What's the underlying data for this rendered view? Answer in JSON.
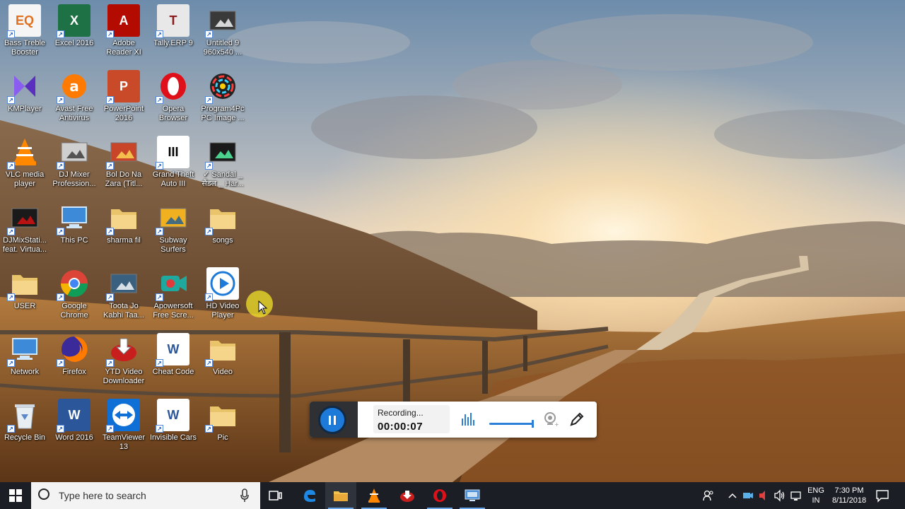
{
  "desktop_icons": [
    {
      "label": "Bass Treble\nBooster",
      "icon": "bass-treble-booster-icon",
      "bg": "#f5f5f5",
      "fg": "#e07020",
      "text": "EQ",
      "col": 0,
      "row": 0
    },
    {
      "label": "Excel 2016",
      "icon": "excel-icon",
      "bg": "#1e7145",
      "fg": "#ffffff",
      "text": "X",
      "col": 1,
      "row": 0
    },
    {
      "label": "Adobe\nReader XI",
      "icon": "adobe-reader-icon",
      "bg": "#b30b00",
      "fg": "#ffffff",
      "text": "A",
      "col": 2,
      "row": 0
    },
    {
      "label": "Tally.ERP 9",
      "icon": "tally-icon",
      "bg": "#e8e8e8",
      "fg": "#8a1a1a",
      "text": "T",
      "col": 3,
      "row": 0
    },
    {
      "label": "Untitled 9\n960x540 ...",
      "icon": "image-file-icon",
      "bg": "#3a3a3a",
      "fg": "#ffffff",
      "text": "",
      "col": 4,
      "row": 0
    },
    {
      "label": "KMPlayer",
      "icon": "kmplayer-icon",
      "bg": "#6a3fc0",
      "fg": "#ffffff",
      "text": "K",
      "col": 0,
      "row": 1
    },
    {
      "label": "Avast Free\nAntivirus",
      "icon": "avast-icon",
      "bg": "#ff7a00",
      "fg": "#ffffff",
      "text": "a",
      "col": 1,
      "row": 1
    },
    {
      "label": "PowerPoint\n2016",
      "icon": "powerpoint-icon",
      "bg": "#c94a28",
      "fg": "#ffffff",
      "text": "P",
      "col": 2,
      "row": 1
    },
    {
      "label": "Opera\nBrowser",
      "icon": "opera-icon",
      "bg": "#e0101a",
      "fg": "#ffffff",
      "text": "O",
      "col": 3,
      "row": 1
    },
    {
      "label": "Program4Pc\nPC Image ...",
      "icon": "program4pc-icon",
      "bg": "#222222",
      "fg": "#ffcc00",
      "text": "",
      "col": 4,
      "row": 1
    },
    {
      "label": "VLC media\nplayer",
      "icon": "vlc-icon",
      "bg": "transparent",
      "fg": "#ff8800",
      "text": "",
      "col": 0,
      "row": 2
    },
    {
      "label": "DJ Mixer\nProfession...",
      "icon": "dj-mixer-icon",
      "bg": "#cfcfcf",
      "fg": "#333333",
      "text": "",
      "col": 1,
      "row": 2
    },
    {
      "label": "Bol Do Na\nZara (Titl...",
      "icon": "video-file-icon",
      "bg": "#c9452a",
      "fg": "#ffdd55",
      "text": "",
      "col": 2,
      "row": 2
    },
    {
      "label": "Grand Theft\nAuto III",
      "icon": "gta-icon",
      "bg": "#ffffff",
      "fg": "#000000",
      "text": "III",
      "col": 3,
      "row": 2
    },
    {
      "label": "✓ Sandal _\nसैंडल _ Har...",
      "icon": "video-file-icon",
      "bg": "#1a1a1a",
      "fg": "#55ffaa",
      "text": "",
      "col": 4,
      "row": 2
    },
    {
      "label": "DJMixStati...\nfeat. Virtua...",
      "icon": "djmixstation-icon",
      "bg": "#1a1a1a",
      "fg": "#e01010",
      "text": "",
      "col": 0,
      "row": 3
    },
    {
      "label": "This PC",
      "icon": "this-pc-icon",
      "bg": "transparent",
      "fg": "#4aa3e8",
      "text": "",
      "col": 1,
      "row": 3
    },
    {
      "label": "sharma fil",
      "icon": "folder-icon",
      "bg": "#e6c56a",
      "fg": "#ffffff",
      "text": "",
      "col": 2,
      "row": 3
    },
    {
      "label": "Subway\nSurfers",
      "icon": "subway-surfers-icon",
      "bg": "#f0b020",
      "fg": "#1a5a9a",
      "text": "",
      "col": 3,
      "row": 3
    },
    {
      "label": "songs",
      "icon": "folder-icon",
      "bg": "#e6c56a",
      "fg": "#ffffff",
      "text": "",
      "col": 4,
      "row": 3
    },
    {
      "label": "USER",
      "icon": "user-folder-icon",
      "bg": "#e6c56a",
      "fg": "#2b8a6e",
      "text": "",
      "col": 0,
      "row": 4
    },
    {
      "label": "Google\nChrome",
      "icon": "chrome-icon",
      "bg": "transparent",
      "fg": "#ffffff",
      "text": "",
      "col": 1,
      "row": 4
    },
    {
      "label": "Toota Jo\nKabhi Taa...",
      "icon": "video-file-icon",
      "bg": "#3a6080",
      "fg": "#ffffff",
      "text": "",
      "col": 2,
      "row": 4
    },
    {
      "label": "Apowersoft\nFree Scre...",
      "icon": "apowersoft-icon",
      "bg": "#1fa89e",
      "fg": "#ffffff",
      "text": "",
      "col": 3,
      "row": 4
    },
    {
      "label": "HD Video\nPlayer",
      "icon": "hd-video-player-icon",
      "bg": "#ffffff",
      "fg": "#1e7ad9",
      "text": "",
      "col": 4,
      "row": 4
    },
    {
      "label": "Network",
      "icon": "network-icon",
      "bg": "transparent",
      "fg": "#4aa3e8",
      "text": "",
      "col": 0,
      "row": 5
    },
    {
      "label": "Firefox",
      "icon": "firefox-icon",
      "bg": "transparent",
      "fg": "#ff6a00",
      "text": "",
      "col": 1,
      "row": 5
    },
    {
      "label": "YTD Video\nDownloader",
      "icon": "ytd-downloader-icon",
      "bg": "transparent",
      "fg": "#d01010",
      "text": "",
      "col": 2,
      "row": 5
    },
    {
      "label": "Cheat Code",
      "icon": "word-document-icon",
      "bg": "#ffffff",
      "fg": "#2b579a",
      "text": "W",
      "col": 3,
      "row": 5
    },
    {
      "label": "Video",
      "icon": "folder-icon",
      "bg": "#e6c56a",
      "fg": "#ffffff",
      "text": "",
      "col": 4,
      "row": 5
    },
    {
      "label": "Recycle Bin",
      "icon": "recycle-bin-icon",
      "bg": "transparent",
      "fg": "#dfe8f0",
      "text": "",
      "col": 0,
      "row": 6
    },
    {
      "label": "Word 2016",
      "icon": "word-icon",
      "bg": "#2b579a",
      "fg": "#ffffff",
      "text": "W",
      "col": 1,
      "row": 6
    },
    {
      "label": "TeamViewer\n13",
      "icon": "teamviewer-icon",
      "bg": "#0e6fd6",
      "fg": "#ffffff",
      "text": "",
      "col": 2,
      "row": 6
    },
    {
      "label": "Invisible Cars",
      "icon": "word-document-icon",
      "bg": "#ffffff",
      "fg": "#2b579a",
      "text": "W",
      "col": 3,
      "row": 6
    },
    {
      "label": "Pic",
      "icon": "folder-icon",
      "bg": "#e6c56a",
      "fg": "#ffffff",
      "text": "",
      "col": 4,
      "row": 6
    }
  ],
  "recorder": {
    "status": "Recording...",
    "time": "00:00:07"
  },
  "taskbar": {
    "search_placeholder": "Type here to search",
    "pinned": [
      "task-view-icon",
      "edge-icon",
      "file-explorer-icon",
      "vlc-icon",
      "ytd-downloader-icon",
      "opera-icon",
      "remote-desktop-icon"
    ],
    "lang_line1": "ENG",
    "lang_line2": "IN",
    "time": "7:30 PM",
    "date": "8/11/2018"
  },
  "colors": {
    "taskbar": "#1b1e24",
    "accent": "#1e7ad9"
  }
}
